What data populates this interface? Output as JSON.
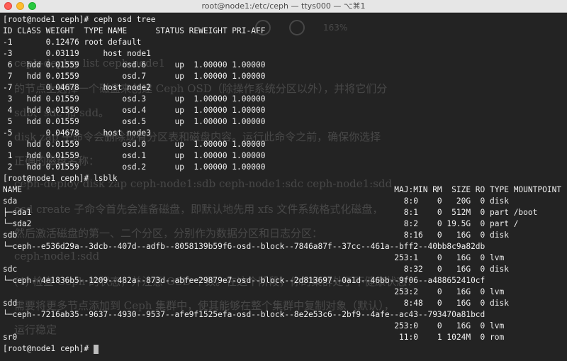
{
  "window": {
    "title": "root@node1:/etc/ceph — ttys000 — ⌥⌘1"
  },
  "terminal": {
    "lines": [
      "[root@node1 ceph]# ceph osd tree",
      "ID CLASS WEIGHT  TYPE NAME      STATUS REWEIGHT PRI-AFF",
      "-1       0.12476 root default",
      "-3       0.03119     host node1",
      " 6   hdd 0.01559         osd.6      up  1.00000 1.00000",
      " 7   hdd 0.01559         osd.7      up  1.00000 1.00000",
      "-7       0.04678     host node2",
      " 3   hdd 0.01559         osd.3      up  1.00000 1.00000",
      " 4   hdd 0.01559         osd.4      up  1.00000 1.00000",
      " 5   hdd 0.01559         osd.5      up  1.00000 1.00000",
      "-5       0.04678     host node3",
      " 0   hdd 0.01559         osd.0      up  1.00000 1.00000",
      " 1   hdd 0.01559         osd.1      up  1.00000 1.00000",
      " 2   hdd 0.01559         osd.2      up  1.00000 1.00000",
      "[root@node1 ceph]# lsblk",
      "NAME                                                                              MAJ:MIN RM  SIZE RO TYPE MOUNTPOINT",
      "sda                                                                                 8:0    0   20G  0 disk",
      "├─sda1                                                                              8:1    0  512M  0 part /boot",
      "└─sda2                                                                              8:2    0 19.5G  0 part /",
      "sdb                                                                                 8:16   0   16G  0 disk",
      "└─ceph--e536d29a--3dcb--407d--adfb--8058139b59f6-osd--block--7846a87f--37cc--461a--bff2--40bb8c9a82db",
      "                                                                                  253:1    0   16G  0 lvm",
      "sdc                                                                                 8:32   0   16G  0 disk",
      "└─ceph--4e1836b5--1209--482a--873d--abfee29879e7-osd--block--2d813697--0a1d--46bb--9f06--a488652410cf",
      "                                                                                  253:2    0   16G  0 lvm",
      "sdd                                                                                 8:48   0   16G  0 disk",
      "└─ceph--7216ab35--9637--4930--9537--afe9f1525efa-osd--block--8e2e53c6--2bf9--4afe--ac43--793470a81bcd",
      "                                                                                  253:0    0   16G  0 lvm",
      "sr0                                                                                11:0    1 1024M  0 rom",
      "[root@node1 ceph]# "
    ]
  },
  "background": {
    "zoom": "163%",
    "lines": [
      "ceph-deploy list ceph-node1",
      "                 的节点上选择一个磁盘来创建 Ceph OSD（除操作系统分区以外），并将它们分",
      "      sdb、sdc 和 sdd。",
      "    disk zap 子命令会删除现有分区表和磁盘内容。运行此命令之前，确保你选择",
      "      正确的磁盘名称：",
      "   ceph-deploy disk zap ceph-node1:sdb ceph-node1:sdc ceph-node1:sdd",
      "   osd create 子命令首先会准备磁盘，即默认地先用 xfs 文件系统格式化磁盘，",
      "   然后激活磁盘的第一、二个分区，分别作为数据分区和日志分区：",
      "                                                   ceph-node1:sdd",
      "(4) 检查 Ceph 的状态，并注意 OSD 个数。在这个阶段，你的集群处于不健康状态：",
      "需要将更多节点添加到 Ceph 集群中，使其能够在整个集群中复制对象（默认），",
      "     运行稳定"
    ]
  }
}
